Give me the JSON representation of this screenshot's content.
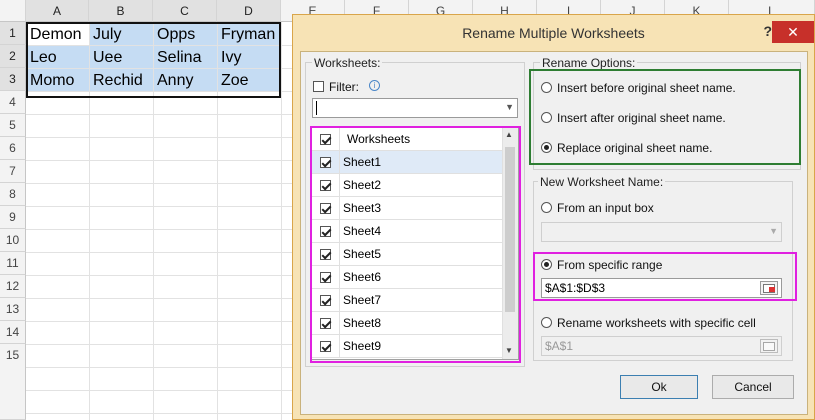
{
  "spreadsheet": {
    "columns": [
      "A",
      "B",
      "C",
      "D",
      "E",
      "F",
      "G",
      "H",
      "I",
      "J",
      "K",
      "L"
    ],
    "rows": [
      "1",
      "2",
      "3",
      "4",
      "5",
      "6",
      "7",
      "8",
      "9",
      "10",
      "11",
      "12",
      "13",
      "14",
      "15"
    ],
    "cells": [
      [
        "Demon",
        "July",
        "Opps",
        "Fryman"
      ],
      [
        "Leo",
        "Uee",
        "Selina",
        "Ivy"
      ],
      [
        "Momo",
        "Rechid",
        "Anny",
        "Zoe"
      ]
    ]
  },
  "dialog": {
    "title": "Rename Multiple Worksheets",
    "help": "?",
    "close": "✕",
    "worksheets_group": "Worksheets:",
    "filter_label": "Filter:",
    "filter_value": "",
    "list_header": "Worksheets",
    "sheets": [
      "Sheet1",
      "Sheet2",
      "Sheet3",
      "Sheet4",
      "Sheet5",
      "Sheet6",
      "Sheet7",
      "Sheet8",
      "Sheet9"
    ],
    "rename_options_group": "Rename Options:",
    "rename_options": [
      "Insert before original sheet name.",
      "Insert after original sheet name.",
      "Replace original sheet name."
    ],
    "new_name_group": "New Worksheet Name:",
    "from_input_box": "From an input box",
    "from_specific_range": "From specific range",
    "range_value": "$A$1:$D$3",
    "rename_with_cell": "Rename worksheets with specific cell",
    "cell_value": "$A$1",
    "ok_label": "Ok",
    "cancel_label": "Cancel"
  },
  "colors": {
    "selection_fill": "#c5dcf3",
    "green_highlight": "#2e7d32",
    "magenta_highlight": "#e020e0",
    "close_red": "#c7302a",
    "dialog_frame": "#f7e3b5"
  }
}
